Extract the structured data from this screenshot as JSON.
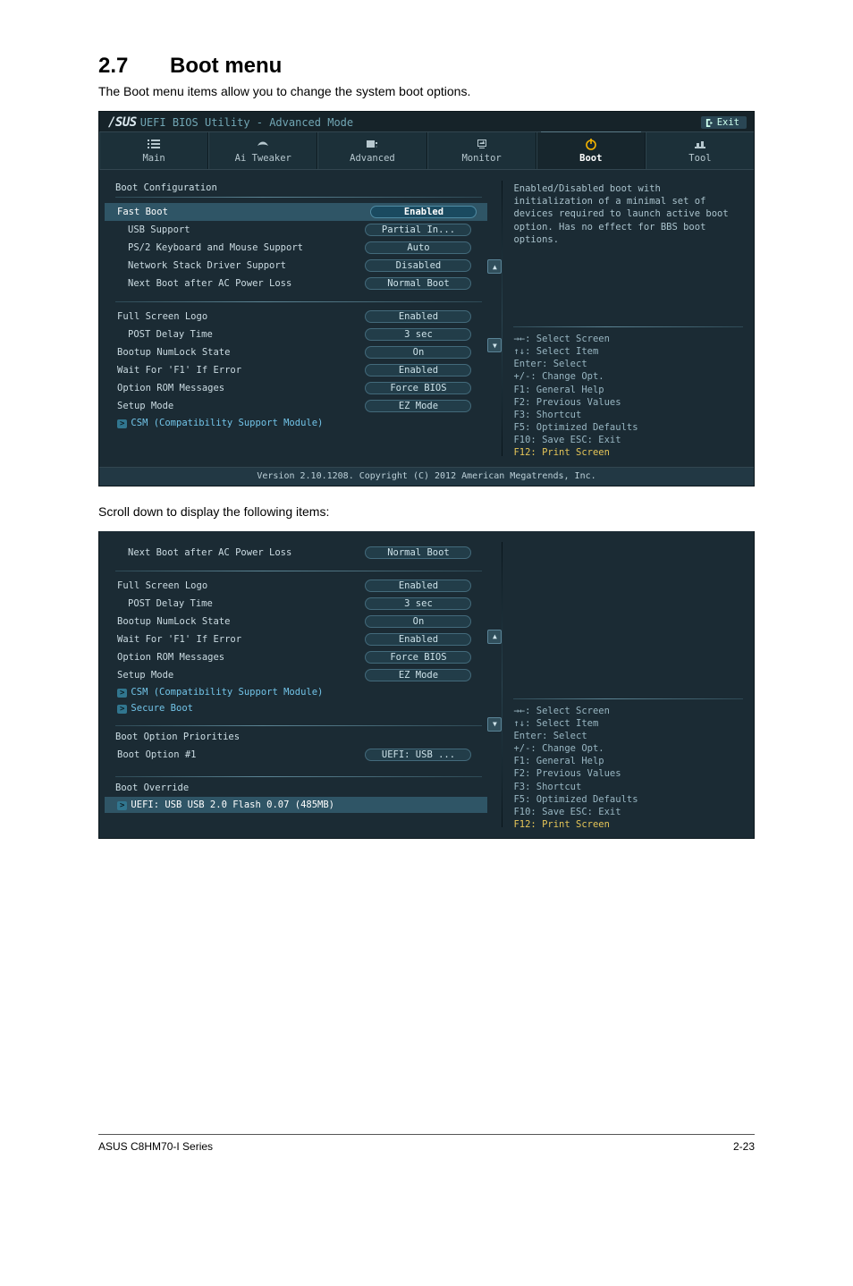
{
  "doc": {
    "section_number": "2.7",
    "section_title": "Boot menu",
    "intro": "The Boot menu items allow you to change the system boot options.",
    "scroll_caption": "Scroll down to display the following items:",
    "footer_left": "ASUS C8HM70-I Series",
    "footer_right": "2-23"
  },
  "bios_header": {
    "logo": "/SUS",
    "title": "UEFI BIOS Utility - Advanced Mode",
    "exit_label": "Exit",
    "tabs": [
      "Main",
      "Ai Tweaker",
      "Advanced",
      "Monitor",
      "Boot",
      "Tool"
    ],
    "active_tab_index": 4,
    "footer": "Version 2.10.1208. Copyright (C) 2012 American Megatrends, Inc."
  },
  "panel1": {
    "heading": "Boot Configuration",
    "rows": [
      {
        "type": "opt",
        "label": "Fast Boot",
        "value": "Enabled",
        "selected": true
      },
      {
        "type": "opt",
        "label": "USB Support",
        "value": "Partial In...",
        "indent": true
      },
      {
        "type": "opt",
        "label": "PS/2 Keyboard and Mouse Support",
        "value": "Auto",
        "indent": true
      },
      {
        "type": "opt",
        "label": "Network Stack Driver Support",
        "value": "Disabled",
        "indent": true
      },
      {
        "type": "opt",
        "label": "Next Boot after AC Power Loss",
        "value": "Normal Boot",
        "indent": true
      }
    ],
    "rows2": [
      {
        "type": "opt",
        "label": "Full Screen Logo",
        "value": "Enabled"
      },
      {
        "type": "opt",
        "label": "POST Delay Time",
        "value": "3 sec",
        "indent": true
      },
      {
        "type": "opt",
        "label": "Bootup NumLock State",
        "value": "On"
      },
      {
        "type": "opt",
        "label": "Wait For 'F1' If Error",
        "value": "Enabled"
      },
      {
        "type": "opt",
        "label": "Option ROM Messages",
        "value": "Force BIOS"
      },
      {
        "type": "opt",
        "label": "Setup Mode",
        "value": "EZ Mode"
      },
      {
        "type": "sub",
        "label": "CSM (Compatibility Support Module)"
      }
    ],
    "help": "Enabled/Disabled boot with initialization of a minimal set of devices required to launch active boot option. Has no effect for BBS boot options.",
    "hints": [
      "→←: Select Screen",
      "↑↓: Select Item",
      "Enter: Select",
      "+/-: Change Opt.",
      "F1: General Help",
      "F2: Previous Values",
      "F3: Shortcut",
      "F5: Optimized Defaults",
      "F10: Save  ESC: Exit"
    ],
    "hint_yellow": "F12: Print Screen"
  },
  "panel2": {
    "rows_top": [
      {
        "type": "opt",
        "label": "Next Boot after AC Power Loss",
        "value": "Normal Boot",
        "indent": true
      }
    ],
    "rows_mid": [
      {
        "type": "opt",
        "label": "Full Screen Logo",
        "value": "Enabled"
      },
      {
        "type": "opt",
        "label": "POST Delay Time",
        "value": "3 sec",
        "indent": true
      },
      {
        "type": "opt",
        "label": "Bootup NumLock State",
        "value": "On"
      },
      {
        "type": "opt",
        "label": "Wait For 'F1' If Error",
        "value": "Enabled"
      },
      {
        "type": "opt",
        "label": "Option ROM Messages",
        "value": "Force BIOS"
      },
      {
        "type": "opt",
        "label": "Setup Mode",
        "value": "EZ Mode"
      },
      {
        "type": "sub",
        "label": "CSM (Compatibility Support Module)"
      },
      {
        "type": "sub",
        "label": "Secure Boot"
      }
    ],
    "priorities_heading": "Boot Option Priorities",
    "priorities": [
      {
        "type": "opt",
        "label": "Boot Option #1",
        "value": "UEFI: USB ..."
      }
    ],
    "override_heading": "Boot Override",
    "override": [
      {
        "type": "sub",
        "label": "UEFI: USB USB 2.0 Flash 0.07 (485MB)",
        "selected": true
      }
    ],
    "hints": [
      "→←: Select Screen",
      "↑↓: Select Item",
      "Enter: Select",
      "+/-: Change Opt.",
      "F1: General Help",
      "F2: Previous Values",
      "F3: Shortcut",
      "F5: Optimized Defaults",
      "F10: Save  ESC: Exit"
    ],
    "hint_yellow": "F12: Print Screen"
  }
}
